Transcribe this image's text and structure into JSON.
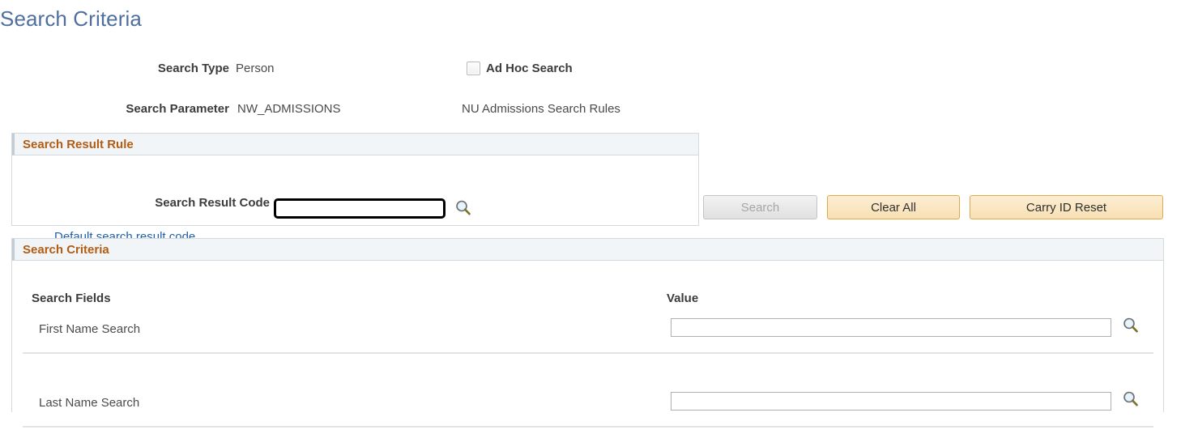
{
  "page": {
    "title": "Search Criteria"
  },
  "top_fields": {
    "search_type_label": "Search Type",
    "search_type_value": "Person",
    "search_parameter_label": "Search Parameter",
    "search_parameter_value": "NW_ADMISSIONS",
    "ad_hoc_search_label": "Ad Hoc Search",
    "ad_hoc_search_checked": false,
    "search_rules_text": "NU Admissions Search Rules"
  },
  "search_result_rule": {
    "header": "Search Result Rule",
    "code_label": "Search Result Code",
    "code_value": "",
    "code_placeholder": "",
    "lookup_icon": "magnifying-glass-icon",
    "default_link": "Default search result code"
  },
  "buttons": {
    "search": "Search",
    "search_enabled": false,
    "clear_all": "Clear All",
    "carry_id_reset": "Carry ID Reset"
  },
  "search_criteria": {
    "header": "Search Criteria",
    "columns": {
      "fields": "Search Fields",
      "value": "Value"
    },
    "rows": [
      {
        "field": "First Name Search",
        "value": "",
        "lookup_icon": "magnifying-glass-icon"
      },
      {
        "field": "Last Name Search",
        "value": "",
        "lookup_icon": "magnifying-glass-icon"
      }
    ]
  },
  "colors": {
    "title_blue": "#4f6f9f",
    "section_header_orange": "#b35c12",
    "section_header_bg": "#f2f5f7",
    "link_blue": "#1f5faa",
    "button_tan_bg": "#f8e0b4",
    "button_tan_border": "#e0a94e",
    "focus_border": "#000000"
  }
}
